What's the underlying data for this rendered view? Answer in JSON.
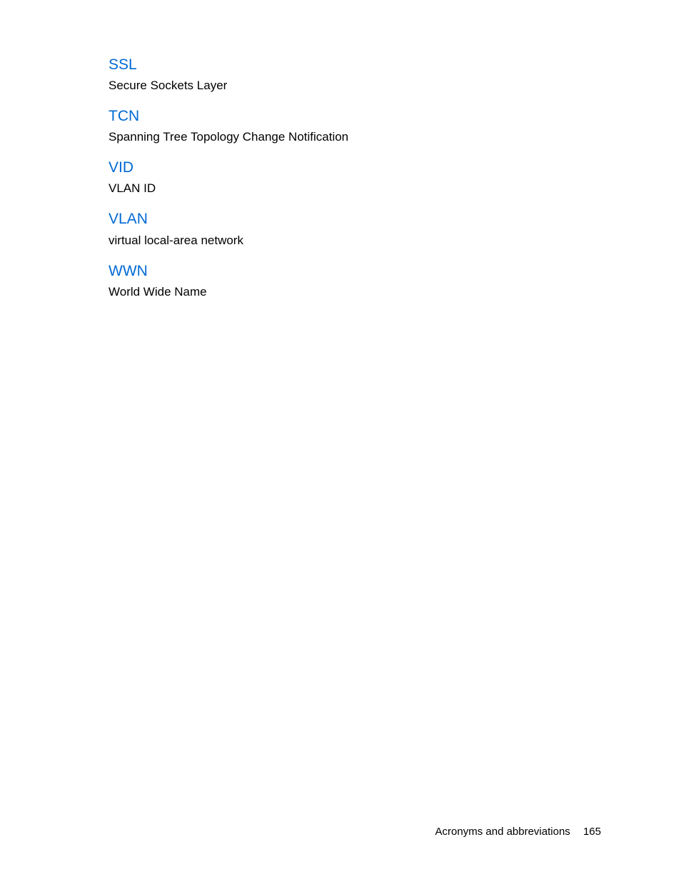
{
  "entries": [
    {
      "term": "SSL",
      "definition": "Secure Sockets Layer"
    },
    {
      "term": "TCN",
      "definition": "Spanning Tree Topology Change Notification"
    },
    {
      "term": "VID",
      "definition": "VLAN ID"
    },
    {
      "term": "VLAN",
      "definition": "virtual local-area network"
    },
    {
      "term": "WWN",
      "definition": "World Wide Name"
    }
  ],
  "footer": {
    "section": "Acronyms and abbreviations",
    "page_number": "165"
  }
}
